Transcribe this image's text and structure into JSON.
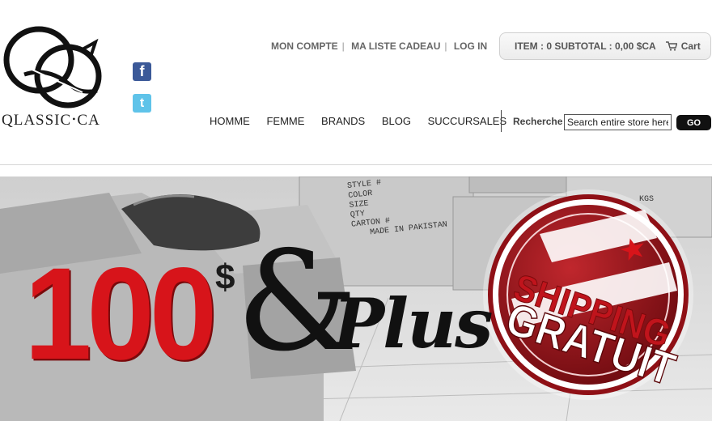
{
  "brand": {
    "name": "QLASSIC",
    "suffix": "CA"
  },
  "social": {
    "facebook_icon": "facebook-icon",
    "twitter_icon": "twitter-icon",
    "facebook_glyph": "f",
    "twitter_glyph": "t"
  },
  "top_links": [
    "MON COMPTE",
    "MA LISTE CADEAU",
    "LOG IN"
  ],
  "cart": {
    "summary": "ITEM : 0 SUBTOTAL : 0,00 $CA",
    "label": "Cart"
  },
  "nav": [
    "HOMME",
    "FEMME",
    "BRANDS",
    "BLOG",
    "SUCCURSALES"
  ],
  "search": {
    "label": "Recherche",
    "value": "Search entire store here...",
    "button": "GO"
  },
  "banner": {
    "amount": "100",
    "currency": "$",
    "ampersand": "&",
    "plus": "Plus",
    "seal_line1": "SHIPPING",
    "seal_line2": "GRATUIT",
    "box_labels": [
      "STYLE #",
      "COLOR",
      "SIZE",
      "QTY",
      "CARTON #",
      "MADE IN PAKISTAN",
      "KGS"
    ]
  },
  "colors": {
    "accent_red": "#d7141a",
    "dark": "#111111"
  }
}
